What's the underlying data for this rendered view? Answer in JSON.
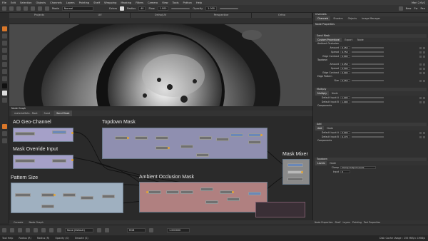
{
  "menubar": {
    "items": [
      "File",
      "Edit",
      "Selection",
      "Objects",
      "Channels",
      "Layers",
      "Painting",
      "Shelf",
      "Wrapping",
      "Masking",
      "Filters",
      "Camera",
      "View",
      "Tools",
      "Python",
      "Help"
    ],
    "right": "Mari 2.6v2"
  },
  "toolbar": {
    "mode_label": "Mode",
    "mode_value": "Normal",
    "color_label": "Colors",
    "radius_label": "Radius",
    "flow_label": "Flow",
    "opacity_label": "Opacity",
    "opacity_value": "1.000",
    "flow_value": "1.000",
    "radius_value": "40",
    "right_labels": [
      "New",
      "Fw",
      "Pen"
    ]
  },
  "viewport": {
    "tabs": [
      "Projects",
      "UV",
      "Ortho/UV",
      "Perspective",
      "Ortho"
    ],
    "info": "1.4.0"
  },
  "nodegraph": {
    "title": "Node Graph",
    "tabs": [
      "materialSets - Root",
      "Sand",
      "Sand Mask"
    ],
    "active_tab": "Sand Mask",
    "backdrops": {
      "ao_geo": "AO Geo-Channel",
      "topdown": "Topdown Mask",
      "mask_override": "Mask Override Input",
      "pattern_size": "Pattern Size",
      "ambient_occlusion": "Ambient Occlusion Mask",
      "mask_mixer": "Mask Mixer"
    },
    "bottom_tabs": [
      "Console",
      "Node Graph"
    ]
  },
  "rpanel": {
    "head": "Channels",
    "tabs": [
      "Channels",
      "Shaders",
      "Objects",
      "Image Manager"
    ],
    "props_head": "Node Properties",
    "sand_mask": {
      "title": "Sand Mask",
      "tabs": [
        "Custom Procedural",
        "Export",
        "Node"
      ],
      "ambient_occlusion": {
        "label": "Ambient Occlusion",
        "rows": [
          {
            "label": "Amount",
            "value": "0.250"
          },
          {
            "label": "Spread",
            "value": "0.750"
          },
          {
            "label": "Edge Contrast",
            "value": "0.000"
          }
        ]
      },
      "topdown": {
        "label": "Topdown",
        "rows": [
          {
            "label": "Amount",
            "value": "0.250"
          },
          {
            "label": "Spread",
            "value": "0.500"
          },
          {
            "label": "Edge Contrast",
            "value": "0.000"
          }
        ]
      },
      "edge_pattern": {
        "label": "Edge Pattern",
        "rows": [
          {
            "label": "Size",
            "value": "0.250"
          }
        ]
      }
    },
    "multiply": {
      "title": "Multiply",
      "tabs": [
        "Multiply",
        "Node"
      ],
      "rows": [
        {
          "label": "Default Input A",
          "value": "1.000"
        },
        {
          "label": "Default Input B",
          "value": "1.000"
        }
      ],
      "components": "Components"
    },
    "add": {
      "title": "Add",
      "tabs": [
        "Add",
        "Node"
      ],
      "rows": [
        {
          "label": "Default Input A",
          "value": "0.000"
        },
        {
          "label": "Default Input B",
          "value": "0.170"
        }
      ],
      "components": "Components"
    },
    "topdown_node": {
      "title": "Topdown",
      "tabs": [
        "Levels",
        "Node"
      ],
      "rows": [
        {
          "label": "Clamp",
          "value": "Clamp Output Levels"
        },
        {
          "label": "Input",
          "value": "0"
        }
      ]
    },
    "bottom_tabs": [
      "Node Properties",
      "Shelf",
      "Layers",
      "Painting",
      "Tool Properties"
    ]
  },
  "bottombar": {
    "mode": "None (Default)",
    "space": "RGB",
    "value": "1.000000"
  },
  "statusbar": {
    "items": [
      "Tool Help",
      "Radius (R)",
      "Radius (R)",
      "Opacity (O)",
      "Smooth (S)"
    ],
    "right": "Disk Cache Usage : 155 MiB/∞ 1MiB/s"
  }
}
